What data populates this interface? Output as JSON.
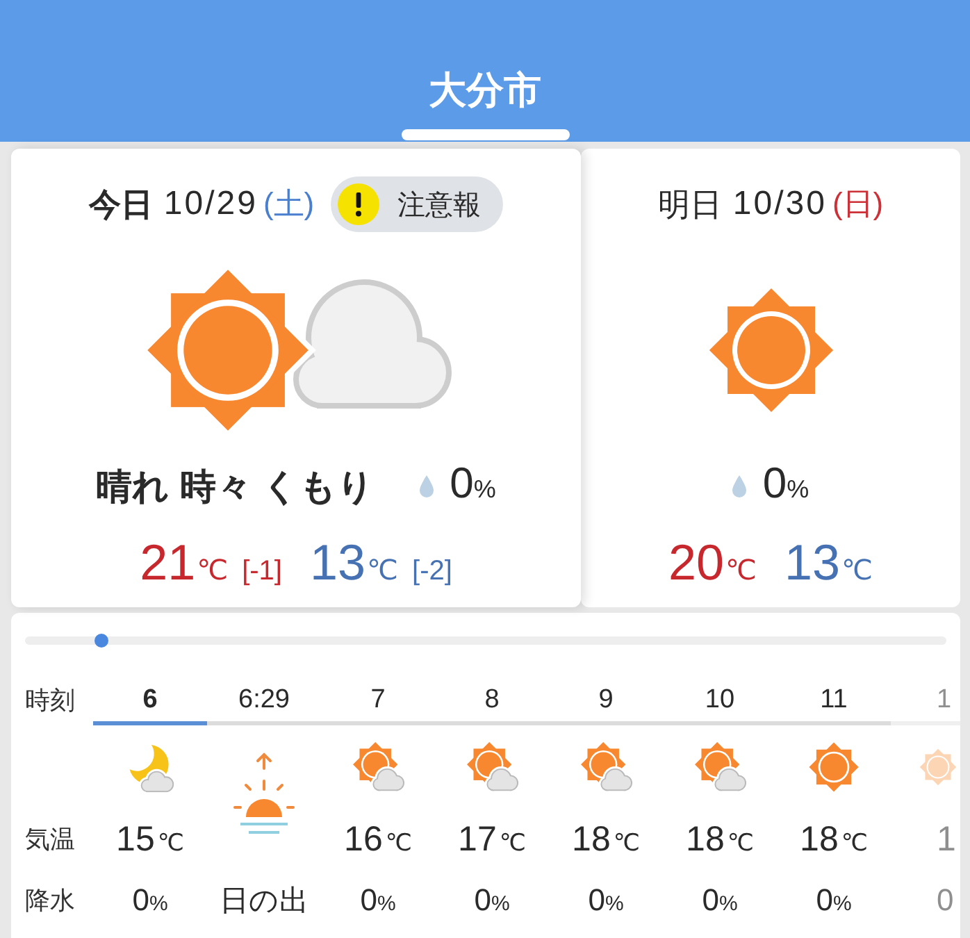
{
  "header": {
    "tabs": [
      {
        "label": "大分市",
        "selected": true
      }
    ]
  },
  "days": [
    {
      "label": "今日",
      "selected": true,
      "date": "10/29",
      "weekday": {
        "text": "(土)",
        "color": "#4a7fcf"
      },
      "alert": {
        "label": "注意報"
      },
      "kind": "sun-cloud",
      "weather": "晴れ 時々 くもり",
      "precip": {
        "value": "0",
        "unit": "%"
      },
      "high": {
        "value": "21",
        "unit": "℃",
        "diff": "[-1]"
      },
      "low": {
        "value": "13",
        "unit": "℃",
        "diff": "[-2]"
      }
    },
    {
      "label": "明日",
      "selected": false,
      "date": "10/30",
      "weekday": {
        "text": "(日)",
        "color": "#cc3138"
      },
      "kind": "sun",
      "precip": {
        "value": "0",
        "unit": "%"
      },
      "high": {
        "value": "20",
        "unit": "℃"
      },
      "low": {
        "value": "13",
        "unit": "℃"
      }
    }
  ],
  "hourly": {
    "row_labels": [
      "時刻",
      "気温",
      "降水"
    ],
    "hours": [
      {
        "kind": "moon-cloud",
        "time": "6",
        "selected": true,
        "faded": false,
        "temp": {
          "value": "15",
          "unit": "℃"
        },
        "precip": {
          "value": "0",
          "unit": "%"
        }
      },
      {
        "kind": "sunrise",
        "time": "6:29",
        "selected": false,
        "faded": false,
        "label": "日の出"
      },
      {
        "kind": "sun-cloud",
        "time": "7",
        "selected": false,
        "faded": false,
        "temp": {
          "value": "16",
          "unit": "℃"
        },
        "precip": {
          "value": "0",
          "unit": "%"
        }
      },
      {
        "kind": "sun-cloud",
        "time": "8",
        "selected": false,
        "faded": false,
        "temp": {
          "value": "17",
          "unit": "℃"
        },
        "precip": {
          "value": "0",
          "unit": "%"
        }
      },
      {
        "kind": "sun-cloud",
        "time": "9",
        "selected": false,
        "faded": false,
        "temp": {
          "value": "18",
          "unit": "℃"
        },
        "precip": {
          "value": "0",
          "unit": "%"
        }
      },
      {
        "kind": "sun-cloud",
        "time": "10",
        "selected": false,
        "faded": false,
        "temp": {
          "value": "18",
          "unit": "℃"
        },
        "precip": {
          "value": "0",
          "unit": "%"
        }
      },
      {
        "kind": "sun",
        "time": "11",
        "selected": false,
        "faded": false,
        "temp": {
          "value": "18",
          "unit": "℃"
        },
        "precip": {
          "value": "0",
          "unit": "%"
        }
      },
      {
        "kind": "sun",
        "time": "1",
        "selected": false,
        "faded": true,
        "temp": {
          "value": "1"
        },
        "precip": {
          "value": "0"
        }
      }
    ]
  }
}
